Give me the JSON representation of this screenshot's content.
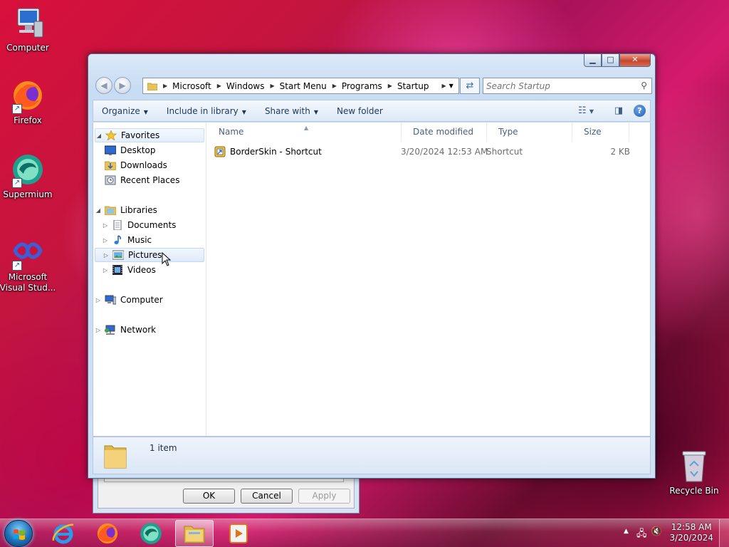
{
  "desktop": {
    "icons": [
      {
        "label": "Computer",
        "icon": "computer-icon"
      },
      {
        "label": "Firefox",
        "icon": "firefox-icon"
      },
      {
        "label": "Supermium",
        "icon": "supermium-icon"
      },
      {
        "label": "Microsoft Visual Stud...",
        "icon": "visual-studio-icon"
      },
      {
        "label": "Recycle Bin",
        "icon": "recycle-bin-icon"
      }
    ]
  },
  "props_dialog": {
    "ok": "OK",
    "cancel": "Cancel",
    "apply": "Apply"
  },
  "explorer": {
    "breadcrumb": [
      "Microsoft",
      "Windows",
      "Start Menu",
      "Programs",
      "Startup"
    ],
    "search_placeholder": "Search Startup",
    "toolbar": {
      "organize": "Organize",
      "include_in_library": "Include in library",
      "share_with": "Share with",
      "new_folder": "New folder"
    },
    "nav": {
      "favorites": "Favorites",
      "desktop": "Desktop",
      "downloads": "Downloads",
      "recent_places": "Recent Places",
      "libraries": "Libraries",
      "documents": "Documents",
      "music": "Music",
      "pictures": "Pictures",
      "videos": "Videos",
      "computer": "Computer",
      "network": "Network"
    },
    "columns": {
      "name": "Name",
      "date_modified": "Date modified",
      "type": "Type",
      "size": "Size"
    },
    "files": [
      {
        "name": "BorderSkin - Shortcut",
        "date_modified": "3/20/2024 12:53 AM",
        "type": "Shortcut",
        "size": "2 KB"
      }
    ],
    "status": "1 item"
  },
  "taskbar": {
    "apps": [
      "internet-explorer-icon",
      "firefox-icon",
      "supermium-icon",
      "file-explorer-icon",
      "media-player-icon"
    ],
    "time": "12:58 AM",
    "date": "3/20/2024"
  },
  "colors": {
    "window_frame": "#c8dcf3",
    "accent": "#1e5db2"
  }
}
